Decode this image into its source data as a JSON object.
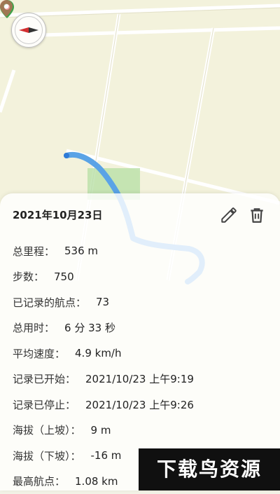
{
  "map": {
    "compass_icon": "compass-icon",
    "start_marker_icon": "map-pin-green",
    "end_marker_icon": "map-pin-red",
    "track_color": "#5aa3e6",
    "background_color": "#f3f2dc",
    "road_color": "#ffffff"
  },
  "track": {
    "date": "2021年10月23日",
    "edit_icon": "pencil-icon",
    "delete_icon": "trash-icon",
    "stats": [
      {
        "label": "总里程：",
        "value": "536 m"
      },
      {
        "label": "步数：",
        "value": "750"
      },
      {
        "label": "已记录的航点：",
        "value": "73"
      },
      {
        "label": "总用时：",
        "value": "6 分 33 秒"
      },
      {
        "label": "平均速度：",
        "value": "4.9 km/h"
      },
      {
        "label": "记录已开始：",
        "value": "2021/10/23 上午9:19"
      },
      {
        "label": "记录已停止：",
        "value": "2021/10/23 上午9:26"
      },
      {
        "label": "海拔（上坡）：",
        "value": "9 m"
      },
      {
        "label": "海拔（下坡）：",
        "value": "-16 m"
      },
      {
        "label": "最高航点：",
        "value": "1.08 km"
      }
    ]
  },
  "watermark": {
    "text": "下载鸟资源"
  }
}
